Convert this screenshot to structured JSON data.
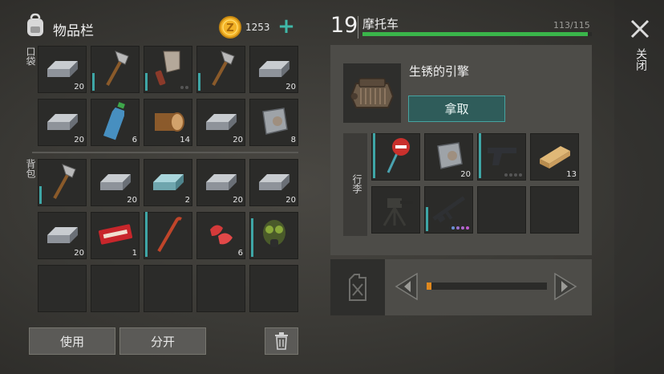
{
  "inventory": {
    "title": "物品栏",
    "coins": "1253",
    "pocket_label": "口袋",
    "backpack_label": "背包"
  },
  "pocket_items": [
    {
      "name": "iron-bar",
      "qty": "20"
    },
    {
      "name": "hatchet",
      "qty": ""
    },
    {
      "name": "cleaver",
      "qty": ""
    },
    {
      "name": "hatchet",
      "qty": ""
    },
    {
      "name": "iron-bar",
      "qty": "20"
    },
    {
      "name": "iron-bar",
      "qty": "20"
    },
    {
      "name": "water-bottle",
      "qty": "6"
    },
    {
      "name": "log",
      "qty": "14"
    },
    {
      "name": "iron-bar",
      "qty": "20"
    },
    {
      "name": "metal-plate",
      "qty": "8"
    }
  ],
  "backpack_items": [
    {
      "name": "hatchet",
      "qty": ""
    },
    {
      "name": "iron-bar",
      "qty": "20"
    },
    {
      "name": "aluminium-bar",
      "qty": "2"
    },
    {
      "name": "iron-bar",
      "qty": "20"
    },
    {
      "name": "iron-bar",
      "qty": "20"
    },
    {
      "name": "iron-bar",
      "qty": "20"
    },
    {
      "name": "coupon",
      "qty": "1"
    },
    {
      "name": "crowbar",
      "qty": ""
    },
    {
      "name": "raw-meat",
      "qty": "6"
    },
    {
      "name": "gas-mask",
      "qty": ""
    }
  ],
  "coupon_text": "COMBAT READ COUPON",
  "buttons": {
    "use": "使用",
    "split": "分开"
  },
  "vehicle": {
    "level": "19",
    "name": "摩托车",
    "durability": "113/115",
    "durability_fraction": 0.983,
    "part_name": "生锈的引擎",
    "take_label": "拿取",
    "cargo_label": "行李"
  },
  "cargo_items": [
    {
      "name": "stop-sign",
      "qty": ""
    },
    {
      "name": "metal-plate",
      "qty": "20"
    },
    {
      "name": "pistol",
      "qty": ""
    },
    {
      "name": "wooden-plank",
      "qty": "13"
    },
    {
      "name": "mounted-turret",
      "qty": ""
    },
    {
      "name": "assault-rifle",
      "qty": ""
    }
  ],
  "fuel": {
    "level_fraction": 0.04
  },
  "close_label": "关闭",
  "colors": {
    "accent": "#3ea6a6",
    "health": "#3ab54a",
    "coin": "#f2b227"
  }
}
